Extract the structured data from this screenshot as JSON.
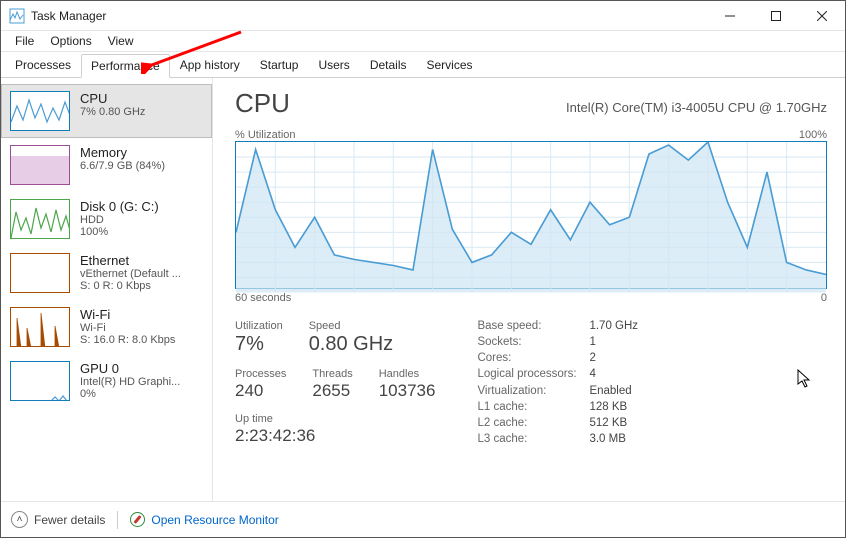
{
  "window": {
    "title": "Task Manager"
  },
  "menu": {
    "file": "File",
    "options": "Options",
    "view": "View"
  },
  "tabs": [
    {
      "label": "Processes"
    },
    {
      "label": "Performance"
    },
    {
      "label": "App history"
    },
    {
      "label": "Startup"
    },
    {
      "label": "Users"
    },
    {
      "label": "Details"
    },
    {
      "label": "Services"
    }
  ],
  "active_tab_index": 1,
  "sidebar": [
    {
      "name": "CPU",
      "sub": "7% 0.80 GHz",
      "sub2": "",
      "kind": "cpu",
      "selected": true
    },
    {
      "name": "Memory",
      "sub": "6.6/7.9 GB (84%)",
      "sub2": "",
      "kind": "mem",
      "selected": false
    },
    {
      "name": "Disk 0 (G: C:)",
      "sub": "HDD",
      "sub2": "100%",
      "kind": "disk",
      "selected": false
    },
    {
      "name": "Ethernet",
      "sub": "vEthernet (Default ...",
      "sub2": "S: 0  R: 0 Kbps",
      "kind": "eth",
      "selected": false
    },
    {
      "name": "Wi-Fi",
      "sub": "Wi-Fi",
      "sub2": "S: 16.0  R: 8.0 Kbps",
      "kind": "wifi",
      "selected": false
    },
    {
      "name": "GPU 0",
      "sub": "Intel(R) HD Graphi...",
      "sub2": "0%",
      "kind": "gpu",
      "selected": false
    }
  ],
  "main": {
    "title": "CPU",
    "model": "Intel(R) Core(TM) i3-4005U CPU @ 1.70GHz",
    "chart": {
      "top_left": "% Utilization",
      "top_right": "100%",
      "bottom_left": "60 seconds",
      "bottom_right": "0",
      "color": "#117dbb"
    },
    "stats_left": {
      "utilization_label": "Utilization",
      "utilization": "7%",
      "speed_label": "Speed",
      "speed": "0.80 GHz",
      "processes_label": "Processes",
      "processes": "240",
      "threads_label": "Threads",
      "threads": "2655",
      "handles_label": "Handles",
      "handles": "103736",
      "uptime_label": "Up time",
      "uptime": "2:23:42:36"
    },
    "stats_right": [
      {
        "k": "Base speed:",
        "v": "1.70 GHz"
      },
      {
        "k": "Sockets:",
        "v": "1"
      },
      {
        "k": "Cores:",
        "v": "2"
      },
      {
        "k": "Logical processors:",
        "v": "4"
      },
      {
        "k": "Virtualization:",
        "v": "Enabled"
      },
      {
        "k": "L1 cache:",
        "v": "128 KB"
      },
      {
        "k": "L2 cache:",
        "v": "512 KB"
      },
      {
        "k": "L3 cache:",
        "v": "3.0 MB"
      }
    ]
  },
  "footer": {
    "fewer": "Fewer details",
    "orm": "Open Resource Monitor"
  },
  "chart_data": {
    "type": "line",
    "title": "% Utilization",
    "xlabel": "60 seconds → 0",
    "ylabel": "% Utilization",
    "ylim": [
      0,
      100
    ],
    "x_seconds_ago": [
      60,
      58,
      56,
      54,
      52,
      50,
      48,
      46,
      44,
      42,
      40,
      38,
      36,
      34,
      32,
      30,
      28,
      26,
      24,
      22,
      20,
      18,
      16,
      14,
      12,
      10,
      8,
      6,
      4,
      2,
      0
    ],
    "values": [
      40,
      95,
      55,
      30,
      50,
      25,
      22,
      20,
      18,
      15,
      95,
      42,
      20,
      25,
      40,
      32,
      55,
      35,
      60,
      45,
      50,
      92,
      98,
      88,
      100,
      60,
      30,
      80,
      20,
      15,
      12
    ],
    "color": "#4a9cd4"
  }
}
